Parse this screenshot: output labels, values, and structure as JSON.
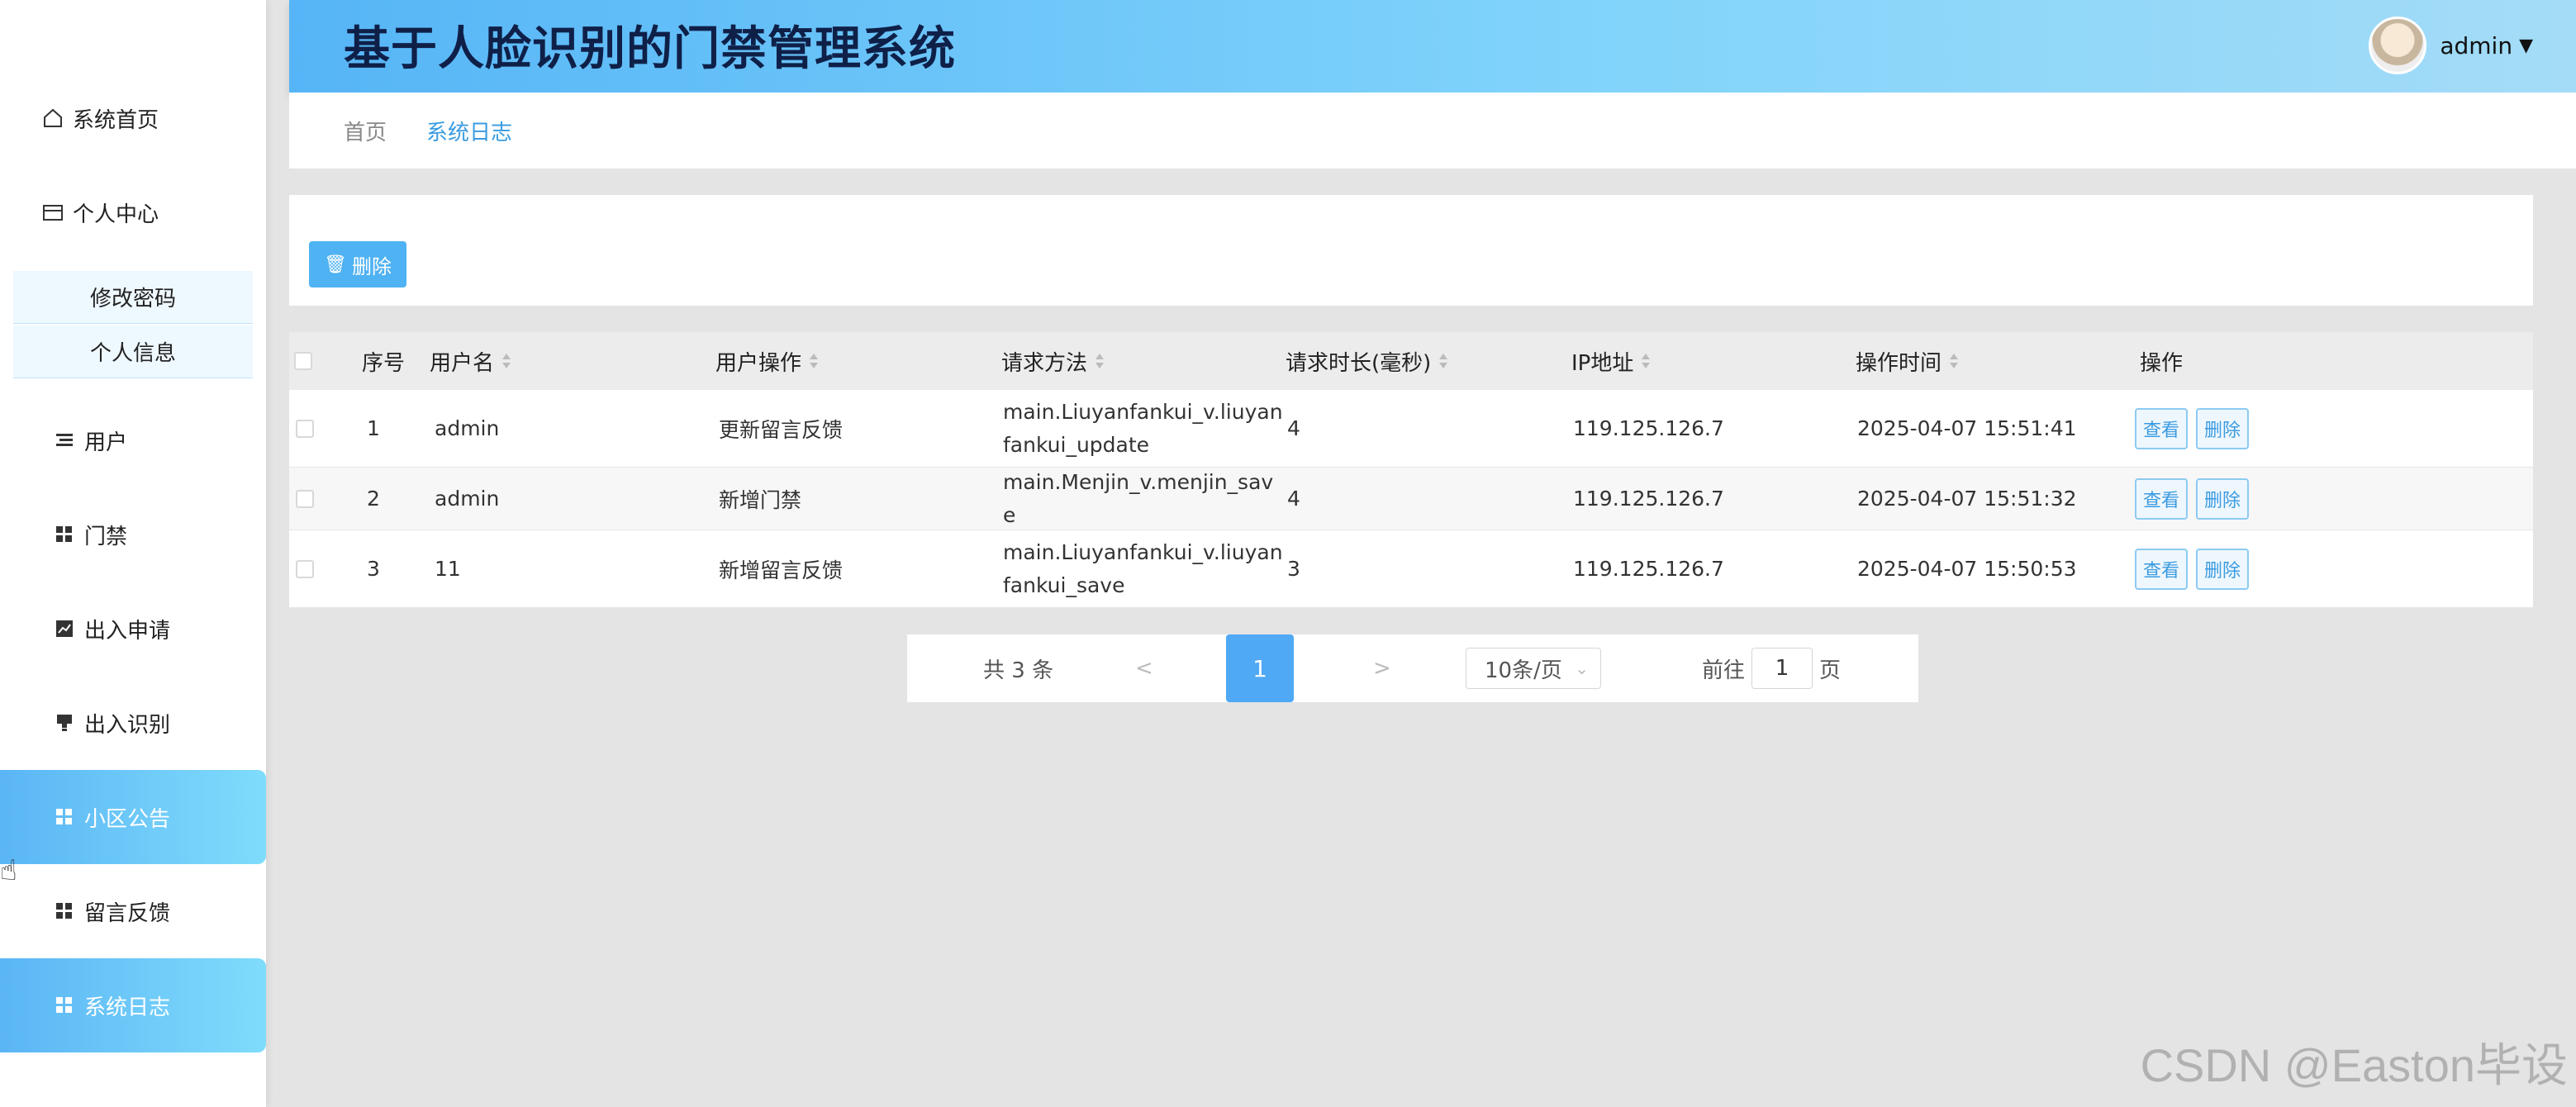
{
  "app": {
    "title": "基于人脸识别的门禁管理系统"
  },
  "user": {
    "name": "admin"
  },
  "sidebar": {
    "home": "系统首页",
    "personal_center": "个人中心",
    "sub_items": [
      "修改密码",
      "个人信息"
    ],
    "items": [
      {
        "label": "用户",
        "icon": "list-icon",
        "active": false
      },
      {
        "label": "门禁",
        "icon": "grid-icon",
        "active": false
      },
      {
        "label": "出入申请",
        "icon": "chart-icon",
        "active": false
      },
      {
        "label": "出入识别",
        "icon": "stamp-icon",
        "active": false
      },
      {
        "label": "小区公告",
        "icon": "grid-icon",
        "active": true
      },
      {
        "label": "留言反馈",
        "icon": "grid-icon",
        "active": false
      },
      {
        "label": "系统日志",
        "icon": "grid-icon",
        "active": true
      }
    ]
  },
  "breadcrumb": {
    "home": "首页",
    "current": "系统日志"
  },
  "toolbar": {
    "delete_label": "删除"
  },
  "table": {
    "headers": {
      "index": "序号",
      "username": "用户名",
      "operation": "用户操作",
      "method": "请求方法",
      "duration": "请求时长(毫秒)",
      "ip": "IP地址",
      "time": "操作时间",
      "actions": "操作"
    },
    "rows": [
      {
        "index": "1",
        "username": "admin",
        "operation": "更新留言反馈",
        "method": "main.Liuyanfankui_v.liuyanfankui_update",
        "duration": "4",
        "ip": "119.125.126.7",
        "time": "2025-04-07 15:51:41"
      },
      {
        "index": "2",
        "username": "admin",
        "operation": "新增门禁",
        "method": "main.Menjin_v.menjin_save",
        "duration": "4",
        "ip": "119.125.126.7",
        "time": "2025-04-07 15:51:32"
      },
      {
        "index": "3",
        "username": "11",
        "operation": "新增留言反馈",
        "method": "main.Liuyanfankui_v.liuyanfankui_save",
        "duration": "3",
        "ip": "119.125.126.7",
        "time": "2025-04-07 15:50:53"
      }
    ],
    "view_label": "查看",
    "delete_label": "删除"
  },
  "pagination": {
    "total": "共 3 条",
    "prev": "<",
    "current_page": "1",
    "next": ">",
    "page_size": "10条/页",
    "jump_label": "前往",
    "jump_value": "1",
    "jump_unit": "页"
  },
  "watermark": "CSDN @Easton毕设",
  "colors": {
    "accent": "#4fb2f2",
    "header_from": "#56b5f6",
    "header_to": "#a4dcf7",
    "title": "#0f2048"
  }
}
